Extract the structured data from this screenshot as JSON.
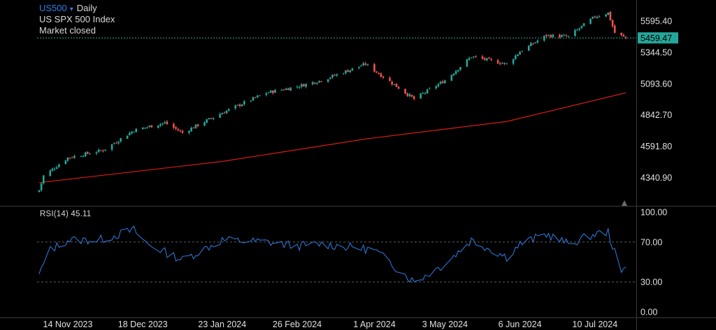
{
  "header": {
    "symbol": "US500",
    "timeframe": "Daily",
    "description": "US SPX 500 Index",
    "status": "Market closed"
  },
  "colors": {
    "background": "#000000",
    "up": "#26a69a",
    "down": "#ef5350",
    "ma": "#d81b1b",
    "rsi": "#2f7fe6",
    "grid": "#262626",
    "axis_text": "#e0e0e0",
    "price_tag": "#26a69a"
  },
  "icons": {
    "symbol_dropdown": "caret-down-icon",
    "scroll_to_latest": "triangle-up-icon"
  },
  "price_pane": {
    "y_ticks": [
      "5595.40",
      "5344.50",
      "5093.60",
      "4842.70",
      "4591.80",
      "4340.90"
    ],
    "last_price": "5459.47"
  },
  "rsi_pane": {
    "label": "RSI(14) 45.11",
    "y_ticks": [
      "100.00",
      "70.00",
      "30.00",
      "0.00"
    ]
  },
  "x_ticks": [
    "14 Nov 2023",
    "18 Dec 2023",
    "23 Jan 2024",
    "26 Feb 2024",
    "1 Apr 2024",
    "3 May 2024",
    "6 Jun 2024",
    "10 Jul 2024"
  ],
  "chart_data": {
    "type": "candlestick",
    "symbol": "US500",
    "interval": "Daily",
    "start_date": "2023-11-01",
    "end_date": "2024-07-24",
    "price_range": [
      4230,
      5680
    ],
    "close_points": [
      {
        "date": "2023-11-01",
        "value": 4240
      },
      {
        "date": "2023-11-03",
        "value": 4355
      },
      {
        "date": "2023-11-14",
        "value": 4500
      },
      {
        "date": "2023-11-30",
        "value": 4560
      },
      {
        "date": "2023-12-14",
        "value": 4720
      },
      {
        "date": "2023-12-28",
        "value": 4780
      },
      {
        "date": "2024-01-05",
        "value": 4700
      },
      {
        "date": "2024-01-23",
        "value": 4860
      },
      {
        "date": "2024-02-12",
        "value": 5020
      },
      {
        "date": "2024-02-26",
        "value": 5070
      },
      {
        "date": "2024-03-08",
        "value": 5120
      },
      {
        "date": "2024-03-28",
        "value": 5250
      },
      {
        "date": "2024-04-19",
        "value": 4970
      },
      {
        "date": "2024-05-03",
        "value": 5120
      },
      {
        "date": "2024-05-15",
        "value": 5310
      },
      {
        "date": "2024-05-31",
        "value": 5250
      },
      {
        "date": "2024-06-06",
        "value": 5350
      },
      {
        "date": "2024-06-18",
        "value": 5480
      },
      {
        "date": "2024-06-28",
        "value": 5470
      },
      {
        "date": "2024-07-10",
        "value": 5630
      },
      {
        "date": "2024-07-16",
        "value": 5660
      },
      {
        "date": "2024-07-19",
        "value": 5500
      },
      {
        "date": "2024-07-24",
        "value": 5459.47
      }
    ],
    "moving_average": [
      {
        "date": "2023-11-01",
        "value": 4300
      },
      {
        "date": "2024-01-23",
        "value": 4470
      },
      {
        "date": "2024-03-28",
        "value": 4650
      },
      {
        "date": "2024-05-31",
        "value": 4790
      },
      {
        "date": "2024-07-24",
        "value": 5020
      }
    ],
    "rsi_range": [
      0,
      100
    ],
    "rsi_levels": [
      70,
      30
    ],
    "rsi": [
      {
        "date": "2023-11-01",
        "value": 38
      },
      {
        "date": "2023-11-06",
        "value": 62
      },
      {
        "date": "2023-11-14",
        "value": 72
      },
      {
        "date": "2023-11-28",
        "value": 72
      },
      {
        "date": "2023-12-14",
        "value": 82
      },
      {
        "date": "2023-12-20",
        "value": 68
      },
      {
        "date": "2024-01-05",
        "value": 52
      },
      {
        "date": "2024-01-23",
        "value": 72
      },
      {
        "date": "2024-02-12",
        "value": 70
      },
      {
        "date": "2024-02-26",
        "value": 66
      },
      {
        "date": "2024-03-08",
        "value": 68
      },
      {
        "date": "2024-04-01",
        "value": 62
      },
      {
        "date": "2024-04-19",
        "value": 30
      },
      {
        "date": "2024-05-03",
        "value": 48
      },
      {
        "date": "2024-05-15",
        "value": 72
      },
      {
        "date": "2024-05-31",
        "value": 55
      },
      {
        "date": "2024-06-06",
        "value": 68
      },
      {
        "date": "2024-06-18",
        "value": 78
      },
      {
        "date": "2024-06-28",
        "value": 68
      },
      {
        "date": "2024-07-10",
        "value": 78
      },
      {
        "date": "2024-07-16",
        "value": 80
      },
      {
        "date": "2024-07-22",
        "value": 38
      },
      {
        "date": "2024-07-24",
        "value": 45.11
      }
    ]
  }
}
